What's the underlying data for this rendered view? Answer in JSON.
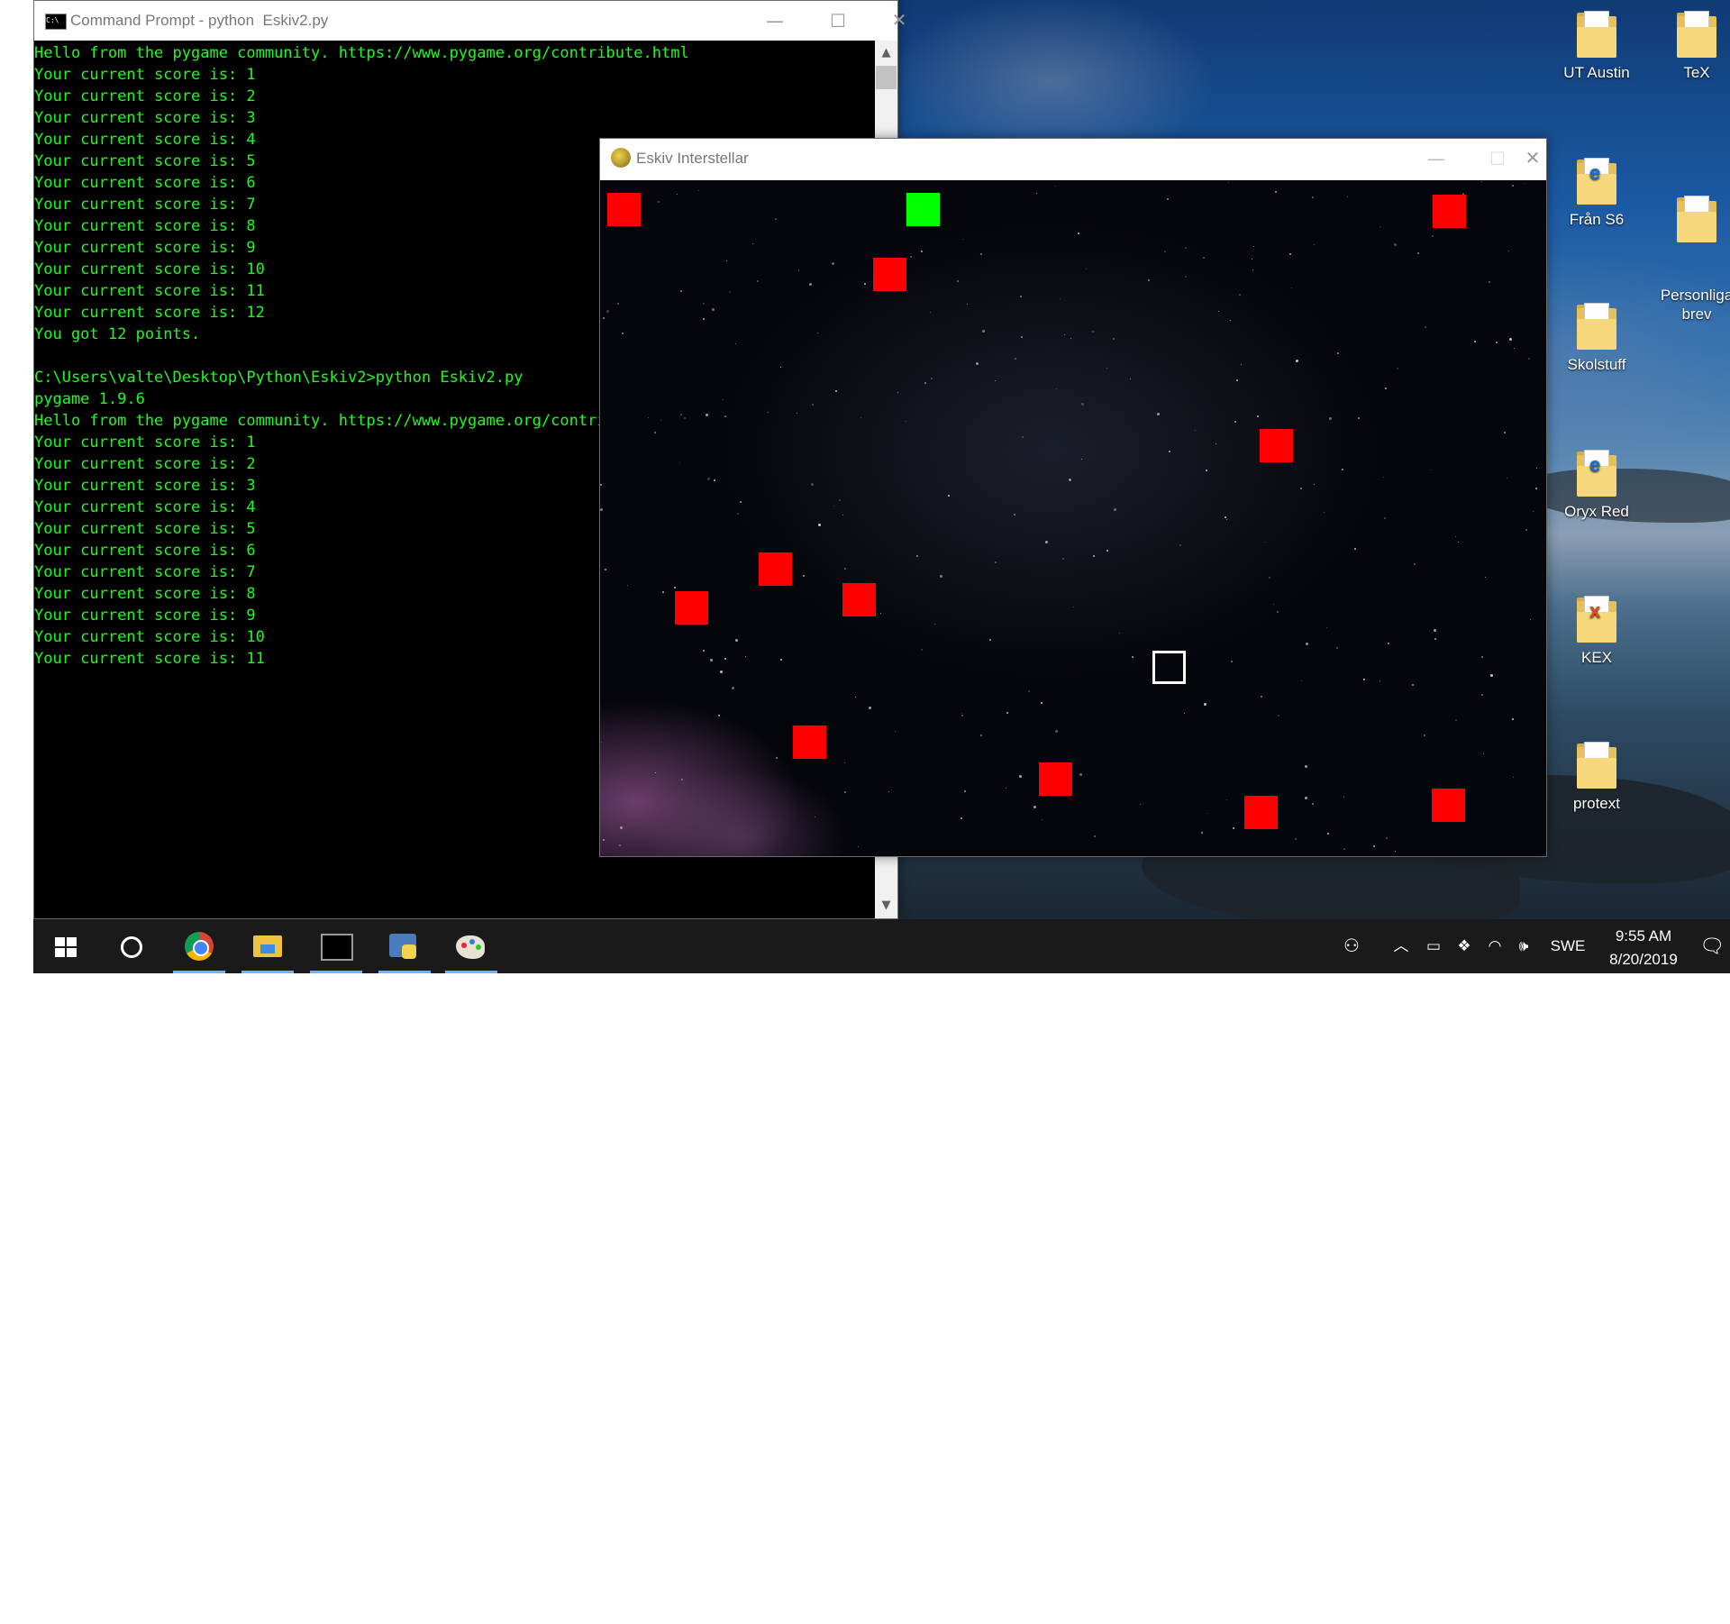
{
  "cmd_window": {
    "title": "Command Prompt - python  Eskiv2.py",
    "lines": [
      "Hello from the pygame community. https://www.pygame.org/contribute.html",
      "Your current score is: 1",
      "Your current score is: 2",
      "Your current score is: 3",
      "Your current score is: 4",
      "Your current score is: 5",
      "Your current score is: 6",
      "Your current score is: 7",
      "Your current score is: 8",
      "Your current score is: 9",
      "Your current score is: 10",
      "Your current score is: 11",
      "Your current score is: 12",
      "You got 12 points.",
      "",
      "C:\\Users\\valte\\Desktop\\Python\\Eskiv2>python Eskiv2.py",
      "pygame 1.9.6",
      "Hello from the pygame community. https://www.pygame.org/contribute.html",
      "Your current score is: 1",
      "Your current score is: 2",
      "Your current score is: 3",
      "Your current score is: 4",
      "Your current score is: 5",
      "Your current score is: 6",
      "Your current score is: 7",
      "Your current score is: 8",
      "Your current score is: 9",
      "Your current score is: 10",
      "Your current score is: 11"
    ],
    "text_color": "#17ff17",
    "window_controls": {
      "minimize": "—",
      "maximize": "☐",
      "close": "✕"
    }
  },
  "game_window": {
    "title": "Eskiv Interstellar",
    "icon": "pygame-snake-icon",
    "window_controls": {
      "minimize": "—",
      "maximize": "☐",
      "close": "✕"
    },
    "colors": {
      "enemy": "#ff0000",
      "goal": "#00ff00",
      "player_outline": "#ffffff"
    }
  },
  "desktop_icons": [
    {
      "label": "UT Austin",
      "icon": "folder-icon"
    },
    {
      "label": "TeX",
      "icon": "folder-icon"
    },
    {
      "label": "Från S6",
      "icon": "folder-icon"
    },
    {
      "label": "Personliga\nbrev",
      "icon": "folder-icon"
    },
    {
      "label": "Skolstuff",
      "icon": "folder-icon"
    },
    {
      "label": "Oryx Red",
      "icon": "folder-icon"
    },
    {
      "label": "KEX",
      "icon": "folder-icon"
    },
    {
      "label": "protext",
      "icon": "folder-icon"
    }
  ],
  "taskbar": {
    "apps": [
      "start-icon",
      "cortana-icon",
      "chrome-icon",
      "file-explorer-icon",
      "command-prompt-icon",
      "python-icon",
      "paint-icon"
    ],
    "tray": {
      "language": "SWE",
      "time": "9:55 AM",
      "date": "8/20/2019"
    }
  }
}
